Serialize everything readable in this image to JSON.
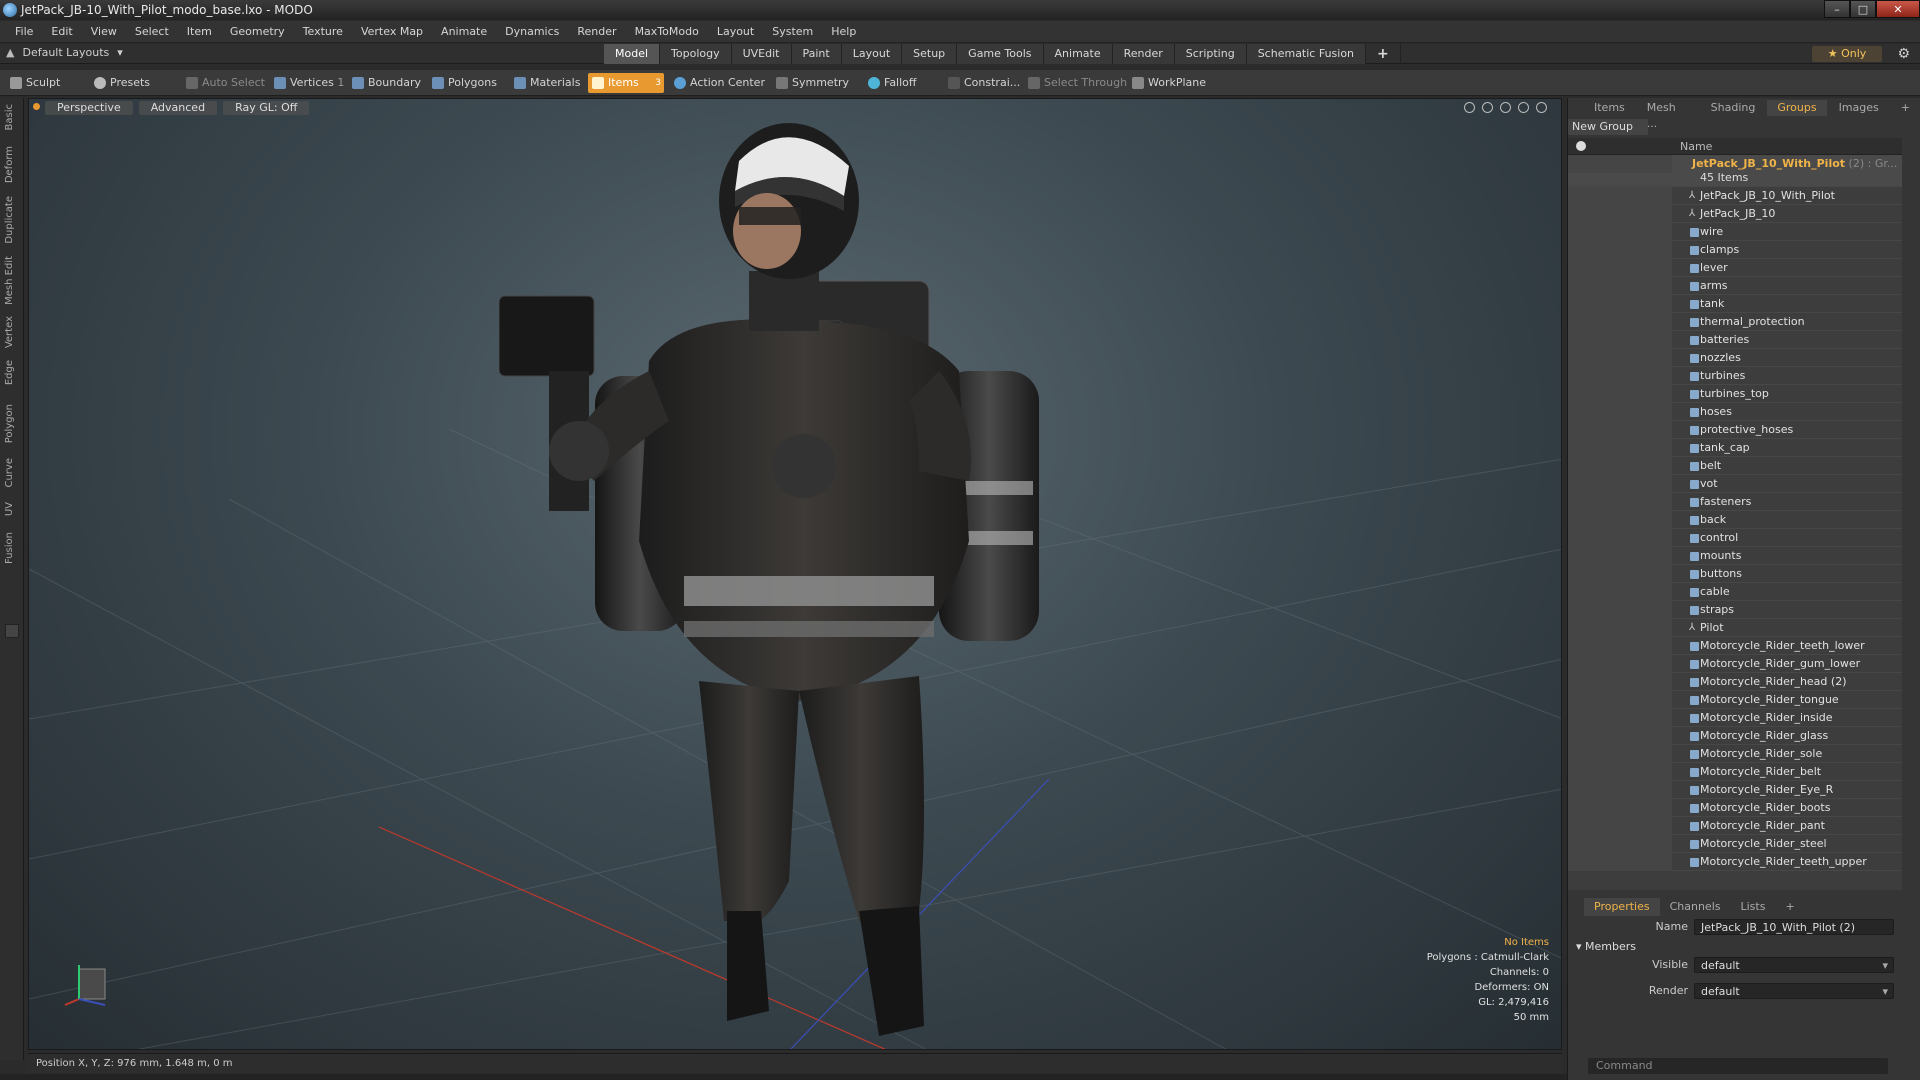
{
  "window": {
    "title": "JetPack_JB-10_With_Pilot_modo_base.lxo - MODO",
    "controls": [
      "–",
      "□",
      "✕"
    ]
  },
  "menu": [
    "File",
    "Edit",
    "View",
    "Select",
    "Item",
    "Geometry",
    "Texture",
    "Vertex Map",
    "Animate",
    "Dynamics",
    "Render",
    "MaxToModo",
    "Layout",
    "System",
    "Help"
  ],
  "layout": {
    "selector": "Default Layouts",
    "tabs": [
      "Model",
      "Topology",
      "UVEdit",
      "Paint",
      "Layout",
      "Setup",
      "Game Tools",
      "Animate",
      "Render",
      "Scripting",
      "Schematic Fusion"
    ],
    "active_tab": "Model",
    "only_label": "Only"
  },
  "toolbar": {
    "sculpt": "Sculpt",
    "presets": "Presets",
    "auto_select": "Auto Select",
    "vertices": "Vertices",
    "vertices_count": "1",
    "boundary": "Boundary",
    "polygons": "Polygons",
    "materials": "Materials",
    "items": "Items",
    "items_count": "3",
    "action_center": "Action Center",
    "symmetry": "Symmetry",
    "falloff": "Falloff",
    "constrain": "Constrai...",
    "select_through": "Select Through",
    "workplane": "WorkPlane",
    "accent": "#e89a30"
  },
  "left_tabs": [
    "Basic",
    "Deform",
    "Duplicate",
    "Mesh Edit",
    "Vertex",
    "Edge",
    "Polygon",
    "Curve",
    "UV",
    "Fusion"
  ],
  "viewport": {
    "mode": "Perspective",
    "advanced": "Advanced",
    "raygl": "Ray GL: Off",
    "info": {
      "no_items": "No Items",
      "polygons": "Polygons : Catmull-Clark",
      "channels": "Channels: 0",
      "deformers": "Deformers: ON",
      "gl": "GL: 2,479,416",
      "focal": "50 mm"
    }
  },
  "status": {
    "position": "Position X, Y, Z:   976 mm, 1.648 m, 0 m"
  },
  "right_panel": {
    "tabs": [
      "Items",
      "Mesh ...",
      "Shading",
      "Groups",
      "Images"
    ],
    "active_tab": "Groups",
    "new_group": "New Group",
    "column_name": "Name",
    "group": {
      "name": "JetPack_JB_10_With_Pilot",
      "suffix": " (2) : Gr...",
      "count": "45 Items"
    },
    "items": [
      {
        "label": "JetPack_JB_10_With_Pilot",
        "type": "locator"
      },
      {
        "label": "JetPack_JB_10",
        "type": "locator"
      },
      {
        "label": "wire",
        "type": "mesh"
      },
      {
        "label": "clamps",
        "type": "mesh"
      },
      {
        "label": "lever",
        "type": "mesh"
      },
      {
        "label": "arms",
        "type": "mesh"
      },
      {
        "label": "tank",
        "type": "mesh"
      },
      {
        "label": "thermal_protection",
        "type": "mesh"
      },
      {
        "label": "batteries",
        "type": "mesh"
      },
      {
        "label": "nozzles",
        "type": "mesh"
      },
      {
        "label": "turbines",
        "type": "mesh"
      },
      {
        "label": "turbines_top",
        "type": "mesh"
      },
      {
        "label": "hoses",
        "type": "mesh"
      },
      {
        "label": "protective_hoses",
        "type": "mesh"
      },
      {
        "label": "tank_cap",
        "type": "mesh"
      },
      {
        "label": "belt",
        "type": "mesh"
      },
      {
        "label": "vot",
        "type": "mesh"
      },
      {
        "label": "fasteners",
        "type": "mesh"
      },
      {
        "label": "back",
        "type": "mesh"
      },
      {
        "label": "control",
        "type": "mesh"
      },
      {
        "label": "mounts",
        "type": "mesh"
      },
      {
        "label": "buttons",
        "type": "mesh"
      },
      {
        "label": "cable",
        "type": "mesh"
      },
      {
        "label": "straps",
        "type": "mesh"
      },
      {
        "label": "Pilot",
        "type": "locator"
      },
      {
        "label": "Motorcycle_Rider_teeth_lower",
        "type": "mesh"
      },
      {
        "label": "Motorcycle_Rider_gum_lower",
        "type": "mesh"
      },
      {
        "label": "Motorcycle_Rider_head (2)",
        "type": "mesh"
      },
      {
        "label": "Motorcycle_Rider_tongue",
        "type": "mesh"
      },
      {
        "label": "Motorcycle_Rider_inside",
        "type": "mesh"
      },
      {
        "label": "Motorcycle_Rider_glass",
        "type": "mesh"
      },
      {
        "label": "Motorcycle_Rider_sole",
        "type": "mesh"
      },
      {
        "label": "Motorcycle_Rider_belt",
        "type": "mesh"
      },
      {
        "label": "Motorcycle_Rider_Eye_R",
        "type": "mesh"
      },
      {
        "label": "Motorcycle_Rider_boots",
        "type": "mesh"
      },
      {
        "label": "Motorcycle_Rider_pant",
        "type": "mesh"
      },
      {
        "label": "Motorcycle_Rider_steel",
        "type": "mesh"
      },
      {
        "label": "Motorcycle_Rider_teeth_upper",
        "type": "mesh"
      }
    ]
  },
  "properties": {
    "tabs": [
      "Properties",
      "Channels",
      "Lists"
    ],
    "active_tab": "Properties",
    "name_label": "Name",
    "name_value": "JetPack_JB_10_With_Pilot (2)",
    "members": "Members",
    "visible_label": "Visible",
    "visible_value": "default",
    "render_label": "Render",
    "render_value": "default",
    "command_placeholder": "Command"
  }
}
